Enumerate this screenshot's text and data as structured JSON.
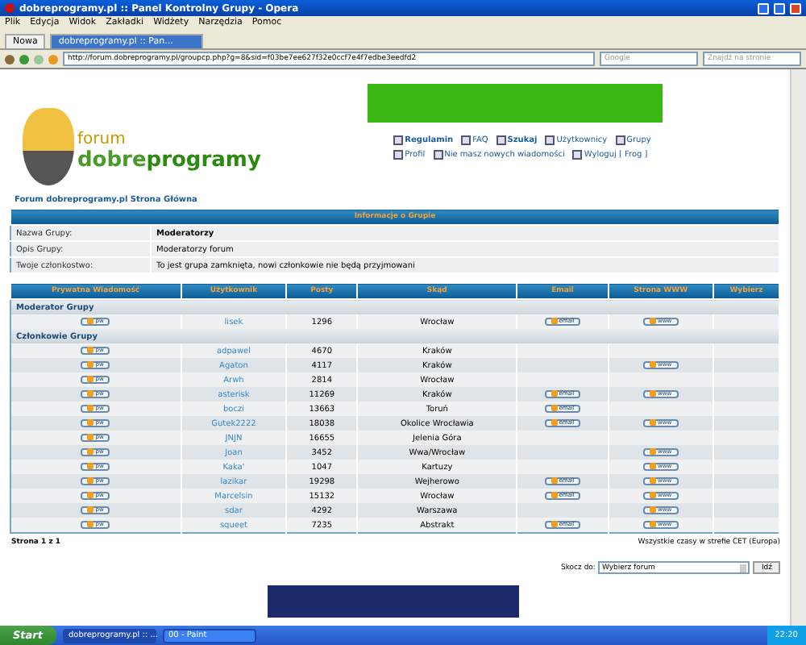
{
  "window": {
    "title": "dobreprogramy.pl :: Panel Kontrolny Grupy - Opera"
  },
  "menu": [
    "Plik",
    "Edycja",
    "Widok",
    "Zakładki",
    "Widżety",
    "Narzędzia",
    "Pomoc"
  ],
  "tabs": [
    {
      "label": "Nowa",
      "selected": false
    },
    {
      "label": "dobreprogramy.pl :: Pan...",
      "selected": true
    }
  ],
  "address": {
    "value": "http://forum.dobreprogramy.pl/groupcp.php?g=8&sid=f03be7ee627f32e0ccf7e4f7edbe3eedfd2"
  },
  "search": {
    "placeholder": "Google"
  },
  "find": {
    "placeholder": "Znajdź na stronie"
  },
  "logo": {
    "top": "forum",
    "left": "dobre",
    "right": "programy"
  },
  "nav": [
    [
      {
        "label": "Regulamin",
        "bold": true
      },
      {
        "label": "FAQ",
        "bold": false
      },
      {
        "label": "Szukaj",
        "bold": true
      },
      {
        "label": "Użytkownicy",
        "bold": false
      },
      {
        "label": "Grupy",
        "bold": false
      }
    ],
    [
      {
        "label": "Profil",
        "bold": false
      },
      {
        "label": "Nie masz nowych wiadomości",
        "bold": false
      },
      {
        "label": "Wyloguj [ Frog ]",
        "bold": false
      }
    ]
  ],
  "breadcrumb": "Forum dobreprogramy.pl Strona Główna",
  "info": {
    "title": "Informacje o Grupie",
    "rows": [
      {
        "label": "Nazwa Grupy:",
        "value": "Moderatorzy",
        "bold": true
      },
      {
        "label": "Opis Grupy:",
        "value": "Moderatorzy forum",
        "bold": false
      },
      {
        "label": "Twoje członkostwo:",
        "value": "To jest grupa zamknięta, nowi członkowie nie będą przyjmowani",
        "bold": false
      }
    ]
  },
  "members": {
    "columns": [
      "Prywatna Wiadomość",
      "Użytkownik",
      "Posty",
      "Skąd",
      "Email",
      "Strona WWW",
      "Wybierz"
    ],
    "sections": [
      {
        "title": "Moderator Grupy",
        "rows": [
          {
            "pm": "pw",
            "user": "lisek",
            "posts": "1296",
            "from": "Wrocław",
            "email": "email",
            "www": "www"
          }
        ]
      },
      {
        "title": "Członkowie Grupy",
        "rows": [
          {
            "pm": "pw",
            "user": "adpawel",
            "posts": "4670",
            "from": "Kraków"
          },
          {
            "pm": "pw",
            "user": "Agaton",
            "posts": "4117",
            "from": "Kraków",
            "www": "www"
          },
          {
            "pm": "pw",
            "user": "Arwh",
            "posts": "2814",
            "from": "Wrocław"
          },
          {
            "pm": "pw",
            "user": "asterisk",
            "posts": "11269",
            "from": "Kraków",
            "email": "email",
            "www": "www"
          },
          {
            "pm": "pw",
            "user": "boczi",
            "posts": "13663",
            "from": "Toruń",
            "email": "email"
          },
          {
            "pm": "pw",
            "user": "Gutek2222",
            "posts": "18038",
            "from": "Okolice Wrocławia",
            "email": "email",
            "www": "www"
          },
          {
            "pm": "pw",
            "user": "JNJN",
            "posts": "16655",
            "from": "Jelenia Góra"
          },
          {
            "pm": "pw",
            "user": "Joan",
            "posts": "3452",
            "from": "Wwa/Wrocław",
            "www": "www"
          },
          {
            "pm": "pw",
            "user": "Kaka'",
            "posts": "1047",
            "from": "Kartuzy",
            "www": "www"
          },
          {
            "pm": "pw",
            "user": "lazikar",
            "posts": "19298",
            "from": "Wejherowo",
            "email": "email",
            "www": "www"
          },
          {
            "pm": "pw",
            "user": "Marcelsin",
            "posts": "15132",
            "from": "Wrocław",
            "email": "email",
            "www": "www"
          },
          {
            "pm": "pw",
            "user": "sdar",
            "posts": "4292",
            "from": "Warszawa",
            "www": "www"
          },
          {
            "pm": "pw",
            "user": "squeet",
            "posts": "7235",
            "from": "Abstrakt",
            "email": "email",
            "www": "www"
          }
        ]
      }
    ]
  },
  "pagination": "Strona 1 z 1",
  "timezone": "Wszystkie czasy w strefie CET (Europa)",
  "jump": {
    "label": "Skocz do:",
    "value": "Wybierz forum",
    "button": "Idź"
  },
  "taskbar": {
    "start": "Start",
    "tasks": [
      {
        "label": "dobreprogramy.pl :: ...",
        "selected": true
      },
      {
        "label": "00 - Paint",
        "selected": false
      }
    ],
    "clock": "22:20"
  }
}
